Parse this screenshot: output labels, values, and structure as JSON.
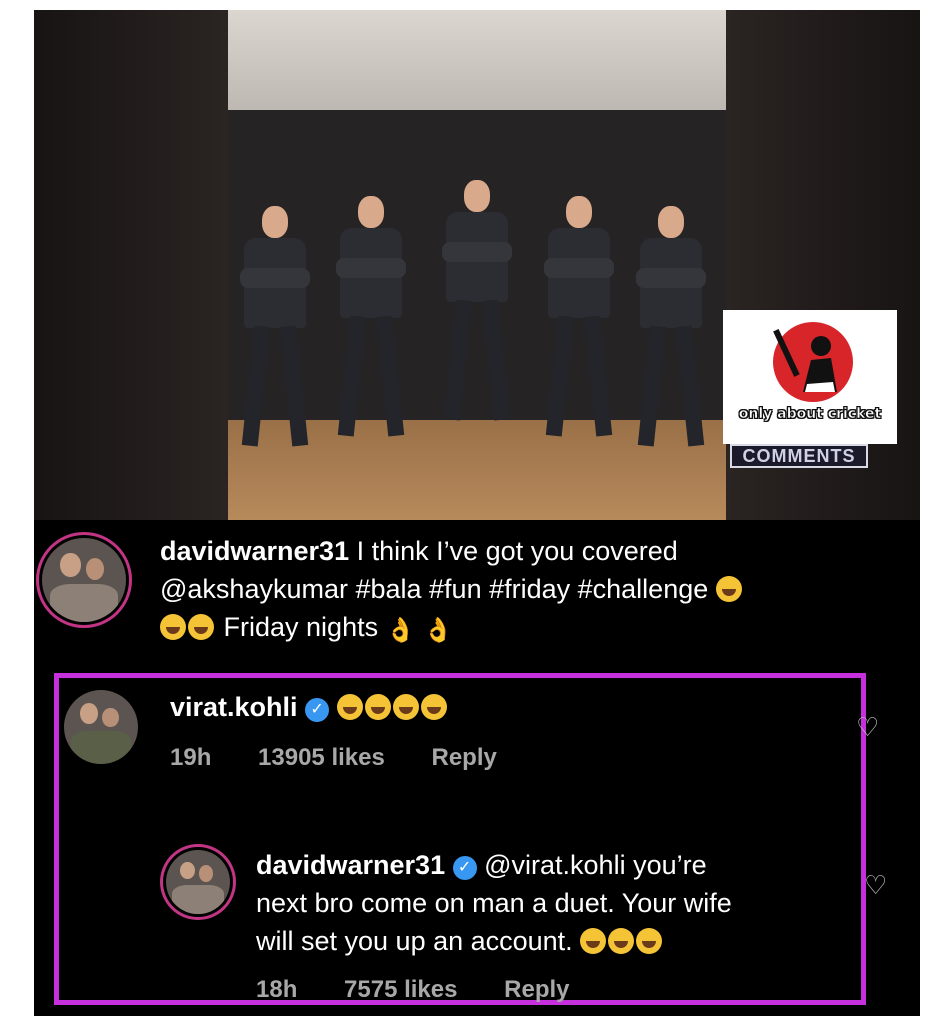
{
  "post": {
    "watermark_brand": "only about cricket",
    "video_tag": "COMMENTS",
    "caption": {
      "username": "davidwarner31",
      "line1": "I think I’ve got you covered",
      "line2": "@akshaykumar #bala #fun #friday #challenge",
      "line3": "Friday nights"
    }
  },
  "comments": [
    {
      "username": "virat.kohli",
      "verified": true,
      "text": "",
      "time": "19h",
      "likes": "13905 likes",
      "reply_label": "Reply"
    },
    {
      "username": "davidwarner31",
      "verified": true,
      "mention": "@virat.kohli",
      "text_line1": "you’re",
      "text_line2": "next bro come on man a duet. Your wife",
      "text_line3": "will set you up an account.",
      "time": "18h",
      "likes": "7575 likes",
      "reply_label": "Reply"
    }
  ],
  "icons": {
    "heart": "heart-outline-icon",
    "verified": "verified-badge-icon",
    "laugh_emoji": "tears-of-joy-emoji",
    "ok_emoji": "ok-hand-emoji"
  },
  "colors": {
    "highlight_border": "#c62fdc",
    "verified_blue": "#3897f0",
    "story_ring": "#c13584",
    "logo_red": "#d7252a"
  }
}
